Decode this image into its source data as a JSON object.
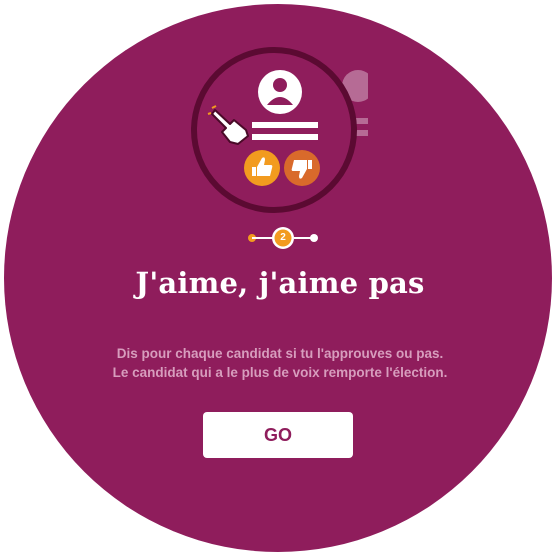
{
  "screen": {
    "title": "J'aime, j'aime pas",
    "description_line1": "Dis pour chaque candidat si tu l'approuves ou pas.",
    "description_line2": "Le candidat qui a le plus de voix remporte l'élection.",
    "go_label": "GO"
  },
  "stepper": {
    "current_step": "2"
  },
  "icons": {
    "candidate": "user-avatar-icon",
    "pointer": "pointing-hand-icon",
    "approve": "thumbs-up-icon",
    "disapprove": "thumbs-down-icon"
  },
  "colors": {
    "background": "#8f1d5c",
    "illustration_circle": "#5b0a32",
    "accent_orange": "#f29b1f",
    "accent_dark_orange": "#d96a2b",
    "button_text": "#8f1d5c",
    "description_text": "#d79dbd"
  }
}
